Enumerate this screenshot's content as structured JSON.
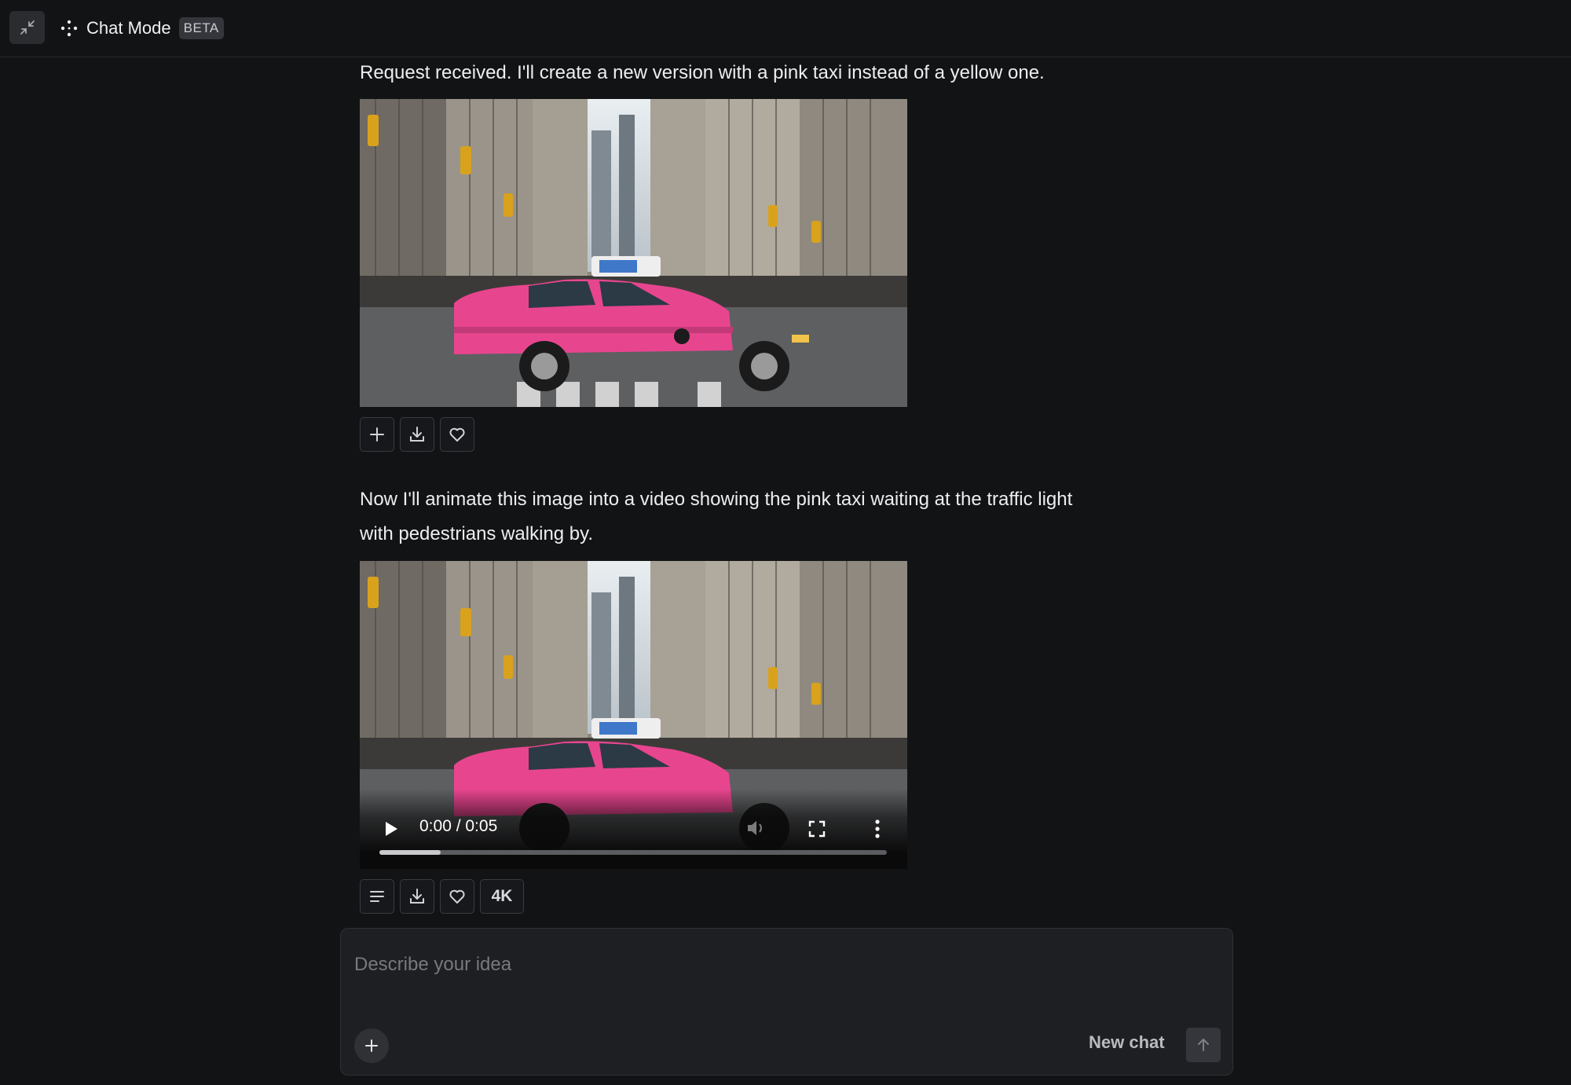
{
  "header": {
    "title": "Chat Mode",
    "badge": "BETA"
  },
  "messages": [
    {
      "text": "Request received. I'll create a new version with a pink taxi instead of a yellow one.",
      "media_type": "image",
      "actions": [
        "plus-icon",
        "download-icon",
        "heart-icon"
      ]
    },
    {
      "text": "Now I'll animate this image into a video showing the pink taxi waiting at the traffic light with pedestrians walking by.",
      "media_type": "video",
      "video": {
        "time": "0:00 / 0:05",
        "progress": 0,
        "buffered": 0.12
      },
      "actions": [
        "text-lines-icon",
        "download-icon",
        "heart-icon"
      ],
      "upscale_label": "4K"
    }
  ],
  "composer": {
    "placeholder": "Describe your idea",
    "new_chat_label": "New chat"
  },
  "colors": {
    "background": "#121315",
    "taxi": "#e8458f",
    "composer": "#1e1f22"
  }
}
